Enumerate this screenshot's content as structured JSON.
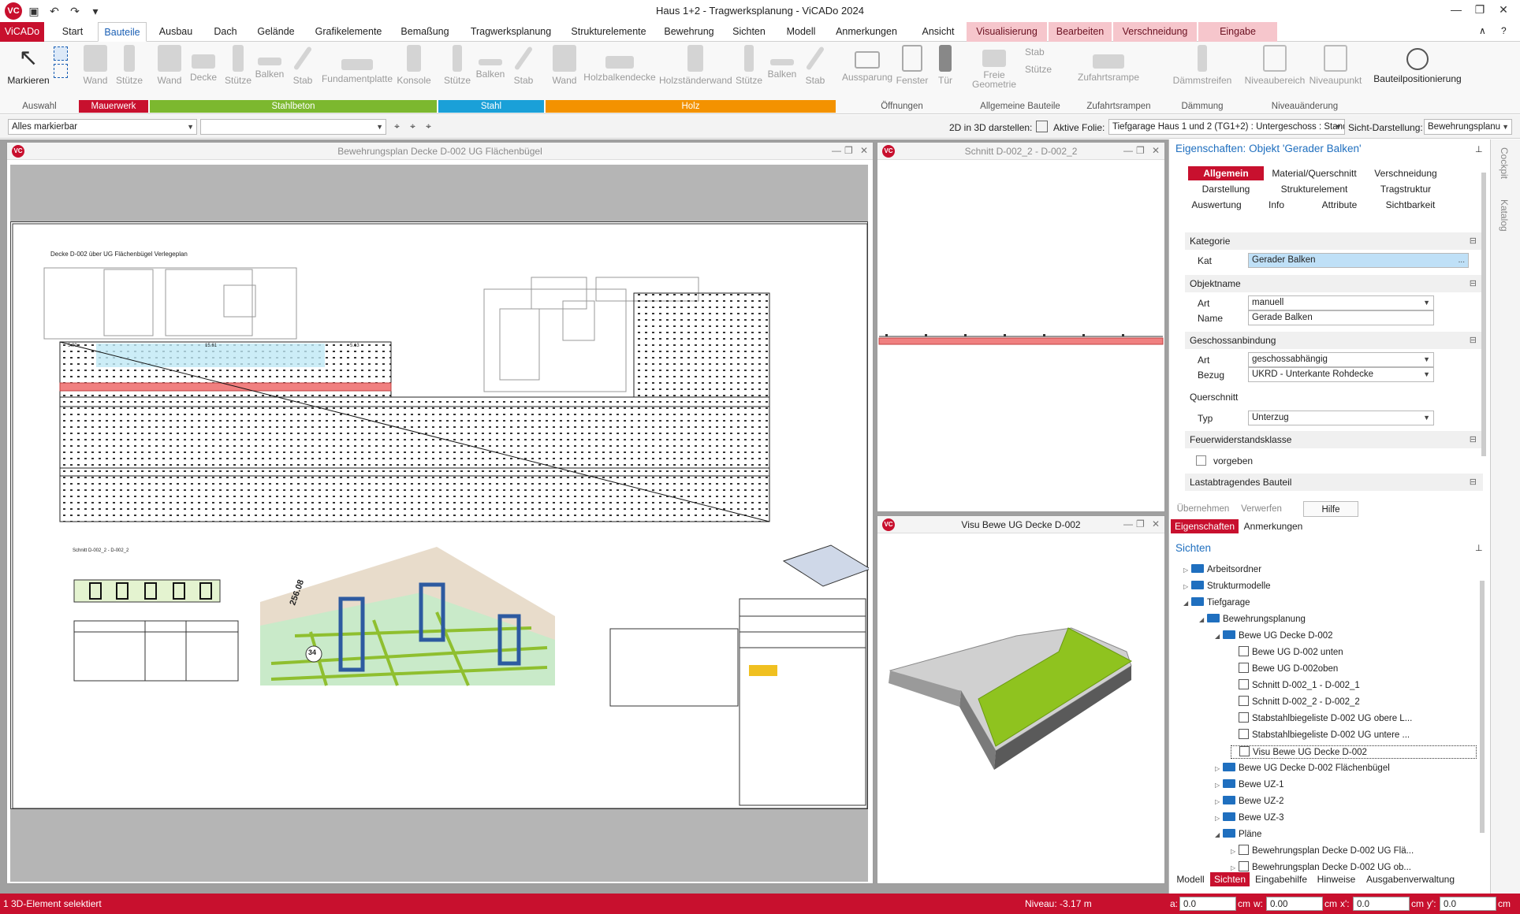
{
  "window": {
    "title": "Haus 1+2 - Tragwerksplanung - ViCADo 2024",
    "app_badge": "VC"
  },
  "quick_access": [
    "save-icon",
    "undo-icon",
    "redo-icon",
    "customize-icon"
  ],
  "tabs": [
    "ViCADo",
    "Start",
    "Bauteile",
    "Ausbau",
    "Dach",
    "Gelände",
    "Grafikelemente",
    "Bemaßung",
    "Tragwerksplanung",
    "Strukturelemente",
    "Bewehrung",
    "Sichten",
    "Modell",
    "Anmerkungen",
    "Ansicht",
    "Visualisierung",
    "Bearbeiten",
    "Verschneidung",
    "Eingabe"
  ],
  "ribbon": {
    "buttons": [
      "Markieren",
      "Wand",
      "Stütze",
      "Wand",
      "Decke",
      "Stütze",
      "Balken",
      "Stab",
      "Fundamentplatte",
      "Konsole",
      "Stütze",
      "Balken",
      "Stab",
      "Wand",
      "Holzbalkendecke",
      "Holzständerwand",
      "Stütze",
      "Balken",
      "Stab",
      "Aussparung",
      "Fenster",
      "Tür",
      "Freie Geometrie",
      "Stab",
      "Stütze",
      "Zufahrtsrampe",
      "Dämmstreifen",
      "Niveaubereich",
      "Niveaupunkt",
      "Bauteilpositionierung"
    ],
    "groups": [
      "Auswahl",
      "Mauerwerk",
      "Stahlbeton",
      "Stahl",
      "Holz",
      "Öffnungen",
      "Allgemeine Bauteile",
      "Zufahrtsrampen",
      "Dämmung",
      "Niveauänderung"
    ],
    "colors": {
      "mauerwerk": "#c8102e",
      "stahlbeton": "#7cb82f",
      "stahl": "#1aa0d8",
      "holz": "#f39200"
    }
  },
  "toolbar": {
    "filter": "Alles markierbar",
    "filter2": "",
    "label_2d3d": "2D in 3D darstellen:",
    "label_folie": "Aktive Folie:",
    "folie": "Tiefgarage Haus 1 und 2 (TG1+2) : Untergeschoss : Stand",
    "label_sicht": "Sicht-Darstellung:",
    "sicht": "Bewehrungsplanu"
  },
  "panes": {
    "main": "Bewehrungsplan Decke D-002 UG Flächenbügel",
    "schnitt": "Schnitt D-002_2 - D-002_2",
    "visu": "Visu Bewe UG Decke D-002",
    "plan_caption": "Decke D-002 über UG Flächenbügel Verlegeplan",
    "section_caption": "Schnitt D-002_2 - D-002_2",
    "dim1": "5.90",
    "dim2": "15.61",
    "dim3": "5.13",
    "dim4": "256.08",
    "mark1": "34"
  },
  "properties": {
    "title": "Eigenschaften: Objekt 'Gerader Balken'",
    "tabs": [
      "Allgemein",
      "Material/Querschnitt",
      "Verschneidung",
      "Darstellung",
      "Strukturelement",
      "Tragstruktur",
      "Auswertung",
      "Info",
      "Attribute",
      "Sichtbarkeit"
    ],
    "sections": {
      "kategorie": "Kategorie",
      "objektname": "Objektname",
      "geschoss": "Geschossanbindung",
      "querschnitt": "Querschnitt",
      "feuer": "Feuerwiderstandsklasse",
      "last": "Lastabtragendes Bauteil"
    },
    "fields": {
      "kat_label": "Kat",
      "kat": "Gerader Balken",
      "art_label": "Art",
      "art": "manuell",
      "name_label": "Name",
      "name": "Gerade Balken",
      "g_art_label": "Art",
      "g_art": "geschossabhängig",
      "bezug_label": "Bezug",
      "bezug": "UKRD - Unterkante Rohdecke",
      "typ_label": "Typ",
      "typ": "Unterzug",
      "vorgeben": "vorgeben",
      "dots": "..."
    },
    "buttons": [
      "Übernehmen",
      "Verwerfen",
      "Hilfe"
    ],
    "bottom_tabs": [
      "Eigenschaften",
      "Anmerkungen"
    ]
  },
  "sichten": {
    "title": "Sichten",
    "tree": [
      {
        "label": "Arbeitsordner",
        "level": 0,
        "type": "folder",
        "tw": "▷"
      },
      {
        "label": "Strukturmodelle",
        "level": 0,
        "type": "folder",
        "tw": "▷"
      },
      {
        "label": "Tiefgarage",
        "level": 0,
        "type": "folder",
        "tw": "◢"
      },
      {
        "label": "Bewehrungsplanung",
        "level": 1,
        "type": "folder",
        "tw": "◢"
      },
      {
        "label": "Bewe UG Decke D-002",
        "level": 2,
        "type": "folder",
        "tw": "◢"
      },
      {
        "label": "Bewe UG D-002 unten",
        "level": 3,
        "type": "doc",
        "tw": ""
      },
      {
        "label": "Bewe UG D-002oben",
        "level": 3,
        "type": "doc",
        "tw": ""
      },
      {
        "label": "Schnitt D-002_1 - D-002_1",
        "level": 3,
        "type": "doc",
        "tw": ""
      },
      {
        "label": "Schnitt D-002_2 - D-002_2",
        "level": 3,
        "type": "doc",
        "tw": ""
      },
      {
        "label": "Stabstahlbiegeliste D-002 UG obere L...",
        "level": 3,
        "type": "doc",
        "tw": ""
      },
      {
        "label": "Stabstahlbiegeliste D-002 UG untere ...",
        "level": 3,
        "type": "doc",
        "tw": ""
      },
      {
        "label": "Visu Bewe UG Decke D-002",
        "level": 3,
        "type": "doc",
        "tw": "",
        "selected": true
      },
      {
        "label": "Bewe UG Decke D-002 Flächenbügel",
        "level": 2,
        "type": "folder",
        "tw": "▷"
      },
      {
        "label": "Bewe UZ-1",
        "level": 2,
        "type": "folder",
        "tw": "▷"
      },
      {
        "label": "Bewe UZ-2",
        "level": 2,
        "type": "folder",
        "tw": "▷"
      },
      {
        "label": "Bewe UZ-3",
        "level": 2,
        "type": "folder",
        "tw": "▷"
      },
      {
        "label": "Pläne",
        "level": 2,
        "type": "folder",
        "tw": "◢"
      },
      {
        "label": "Bewehrungsplan Decke D-002 UG Flä...",
        "level": 3,
        "type": "doc",
        "tw": "▷"
      },
      {
        "label": "Bewehrungsplan Decke D-002 UG ob...",
        "level": 3,
        "type": "doc",
        "tw": "▷"
      }
    ],
    "tabs": [
      "Modell",
      "Sichten",
      "Eingabehilfe",
      "Hinweise",
      "Ausgabenverwaltung"
    ]
  },
  "side_tabs": [
    "Cockpit",
    "Katalog"
  ],
  "status": {
    "left": "1 3D-Element selektiert",
    "niveau": "Niveau: -3.17 m",
    "a_label": "a:",
    "a": "0.0",
    "w_label": "w:",
    "w": "0.00",
    "x_label": "x':",
    "x": "0.0",
    "y_label": "y':",
    "y": "0.0",
    "unit": "cm"
  }
}
